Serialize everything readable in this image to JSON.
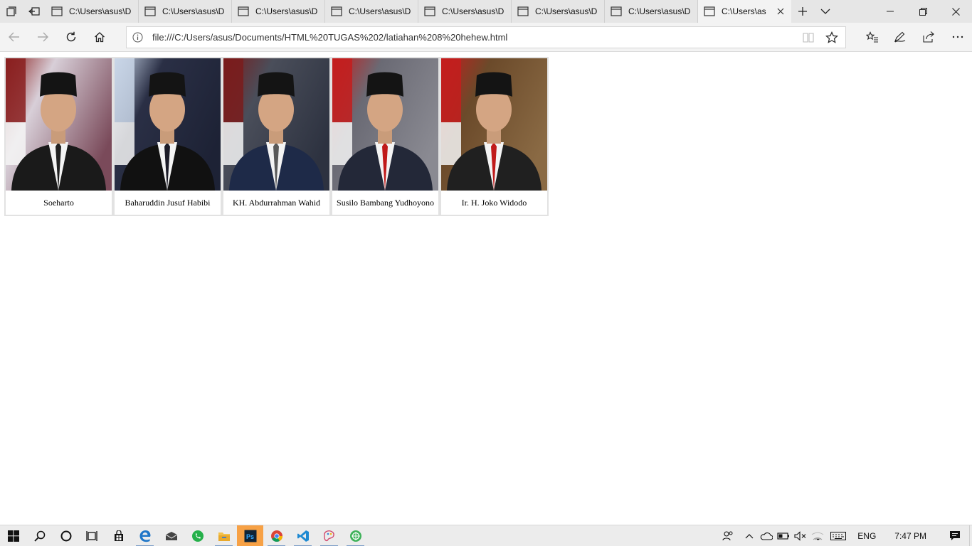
{
  "browser": {
    "tabs": [
      {
        "title": "C:\\Users\\asus\\D"
      },
      {
        "title": "C:\\Users\\asus\\D"
      },
      {
        "title": "C:\\Users\\asus\\D"
      },
      {
        "title": "C:\\Users\\asus\\D"
      },
      {
        "title": "C:\\Users\\asus\\D"
      },
      {
        "title": "C:\\Users\\asus\\D"
      },
      {
        "title": "C:\\Users\\asus\\D"
      }
    ],
    "active_tab": {
      "title": "C:\\Users\\as"
    },
    "address": "file:///C:/Users/asus/Documents/HTML%20TUGAS%202/latiahan%208%20hehew.html"
  },
  "gallery": {
    "cards": [
      {
        "name": "Soeharto",
        "icon": "portrait-photo",
        "bg": [
          "#8a1f1f",
          "#d8cfd8",
          "#7a4a5a"
        ],
        "suit": "#1a1a1a",
        "tie": "#222222"
      },
      {
        "name": "Baharuddin Jusuf Habibi",
        "icon": "portrait-photo",
        "bg": [
          "#c9d6e8",
          "#2a2f45",
          "#1d2235"
        ],
        "suit": "#111111",
        "tie": "#1c1c28"
      },
      {
        "name": "KH. Abdurrahman Wahid",
        "icon": "portrait-photo",
        "bg": [
          "#7a1c1c",
          "#4a4e5a",
          "#2d3240"
        ],
        "suit": "#1e2a48",
        "tie": "#5a5a5a"
      },
      {
        "name": "Susilo Bambang Yudhoyono",
        "icon": "portrait-photo",
        "bg": [
          "#c41d1d",
          "#6a6a74",
          "#8a8a92"
        ],
        "suit": "#232838",
        "tie": "#c01a1a"
      },
      {
        "name": "Ir. H. Joko Widodo",
        "icon": "portrait-photo",
        "bg": [
          "#c41d1d",
          "#6b4a2a",
          "#8a6a44"
        ],
        "suit": "#202020",
        "tie": "#c01a1a"
      }
    ]
  },
  "taskbar": {
    "language": "ENG",
    "time": "7:47 PM",
    "apps": [
      "windows-start",
      "search",
      "cortana",
      "task-view",
      "store",
      "edge",
      "mail",
      "whatsapp",
      "file-explorer",
      "photoshop",
      "chrome",
      "vscode",
      "paint-3d",
      "green-app"
    ]
  },
  "colors": {
    "tabbar": "#e6e6e6",
    "active_tab": "#f3f3f3",
    "taskbar": "#ececec",
    "photoshop_bg": "#f7a145"
  }
}
